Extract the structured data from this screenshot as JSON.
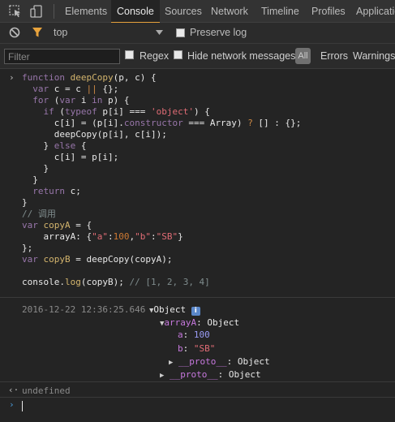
{
  "tabs": [
    "Elements",
    "Console",
    "Sources",
    "Network",
    "Timeline",
    "Profiles",
    "Applicatio"
  ],
  "active_tab": "Console",
  "toolbar": {
    "context": "top",
    "preserve_log": "Preserve log"
  },
  "filter_bar": {
    "filter_placeholder": "Filter",
    "regex": "Regex",
    "hide_network": "Hide network messages",
    "all": "All",
    "errors": "Errors",
    "warnings": "Warnings"
  },
  "code": {
    "l1_kw": "function",
    "l1_fn": "deepCopy",
    "l1_rest": "(p, c) {",
    "l2_kw": "var",
    "l2_rest": " c = c ",
    "l2_op": "||",
    "l2_end": " {};",
    "l3_kw": "for",
    "l3_a": " (",
    "l3_kw2": "var",
    "l3_b": " i ",
    "l3_kw3": "in",
    "l3_c": " p) {",
    "l4_kw": "if",
    "l4_a": " (",
    "l4_kw2": "typeof",
    "l4_b": " p[i] === ",
    "l4_str": "'object'",
    "l4_c": ") {",
    "l5_a": "c[i] = (p[i].",
    "l5_kw": "constructor",
    "l5_b": " === Array) ",
    "l5_op": "?",
    "l5_c": " [] : {};",
    "l6": "deepCopy(p[i], c[i]);",
    "l7_a": "} ",
    "l7_kw": "else",
    "l7_b": " {",
    "l8": "c[i] = p[i];",
    "l9": "}",
    "l10": "}",
    "l11_kw": "return",
    "l11_b": " c;",
    "l12": "}",
    "l13": "// 调用",
    "l14_kw": "var",
    "l14_fn": " copyA",
    "l14_b": " = {",
    "l15_a": "arrayA: {",
    "l15_s1": "\"a\"",
    "l15_b": ":",
    "l15_n": "100",
    "l15_c": ",",
    "l15_s2": "\"b\"",
    "l15_d": ":",
    "l15_s3": "\"SB\"",
    "l15_e": "}",
    "l16": "};",
    "l17_kw": "var",
    "l17_fn": " copyB",
    "l17_b": " = deepCopy(copyA);",
    "l18_a": "console.",
    "l18_fn": "log",
    "l18_b": "(copyB); ",
    "l18_cm": "// [1, 2, 3, 4]"
  },
  "output": {
    "timestamp": "2016-12-22 12:36:25.646",
    "object_label": "Object",
    "arrayA_key": "arrayA",
    "arrayA_val": ": Object",
    "a_key": "a",
    "a_val": "100",
    "b_key": "b",
    "b_val": "\"SB\"",
    "proto_key": "__proto__",
    "proto_val": ": Object",
    "proto2_key": "__proto__",
    "proto2_val": ": Object"
  },
  "result": "undefined"
}
